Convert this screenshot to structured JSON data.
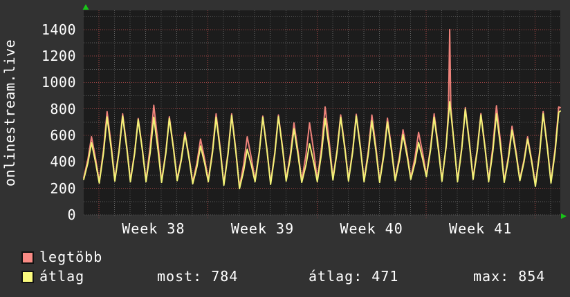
{
  "page": {
    "bg": "#323232",
    "plot_bg": "#1c1c1c",
    "text_color": "#ffffff"
  },
  "y_axis_title": "onlinestream.live",
  "chart_data": {
    "type": "line",
    "title": "",
    "x_tick_labels": [
      "Week 38",
      "Week 39",
      "Week 40",
      "Week 41"
    ],
    "y_ticks": [
      0,
      200,
      400,
      600,
      800,
      1000,
      1200,
      1400
    ],
    "y_minor_step": 100,
    "ylim": [
      0,
      1545
    ],
    "days_total": 30.6,
    "week_line_offset_days": 0.98,
    "grid_on": true,
    "grid": {
      "major_color": "#a04545",
      "minor_color": "#5f5f5f"
    },
    "axis_arrow_color": "#18c418",
    "legend_position": "bottom-left",
    "summary": {
      "most": 784,
      "atlag": 471,
      "max": 854
    },
    "series": [
      {
        "name": "legtöbb",
        "color": "#ef837b",
        "daily_troughs": [
          280,
          252,
          267,
          262,
          262,
          257,
          270,
          247,
          262,
          236,
          210,
          262,
          242,
          267,
          257,
          262,
          275,
          267,
          262,
          257,
          270,
          280,
          300,
          265,
          262,
          280,
          262,
          257,
          270,
          227,
          252
        ],
        "daily_peaks": [
          590,
          780,
          763,
          728,
          828,
          741,
          624,
          572,
          763,
          763,
          590,
          746,
          754,
          694,
          694,
          815,
          755,
          760,
          754,
          730,
          642,
          623,
          763,
          820,
          810,
          765,
          824,
          670,
          590,
          780,
          815
        ],
        "spike": {
          "day_index": 23,
          "value": 1400,
          "shoulder_before": 795,
          "shoulder_after": 818
        },
        "end_value": 810
      },
      {
        "name": "átlag",
        "color": "#f2f277",
        "daily_troughs": [
          268,
          240,
          255,
          250,
          250,
          245,
          258,
          235,
          250,
          224,
          198,
          250,
          230,
          255,
          245,
          250,
          263,
          255,
          250,
          245,
          258,
          268,
          288,
          253,
          250,
          268,
          250,
          245,
          258,
          215,
          240
        ],
        "daily_peaks": [
          545,
          740,
          746,
          720,
          737,
          728,
          608,
          520,
          737,
          750,
          495,
          737,
          741,
          650,
          537,
          728,
          737,
          746,
          710,
          702,
          606,
          546,
          737,
          855,
          798,
          754,
          763,
          640,
          572,
          763,
          775
        ],
        "end_value": 784
      }
    ]
  },
  "legend": {
    "items": [
      {
        "label": "legtöbb",
        "color": "#f98b85"
      },
      {
        "label": "átlag",
        "color": "#fafa7d"
      }
    ],
    "stats": [
      {
        "label": "most",
        "value": "784",
        "text": "most: 784"
      },
      {
        "label": "átlag",
        "value": "471",
        "text": "átlag: 471"
      },
      {
        "label": "max",
        "value": "854",
        "text": "max: 854"
      }
    ]
  }
}
